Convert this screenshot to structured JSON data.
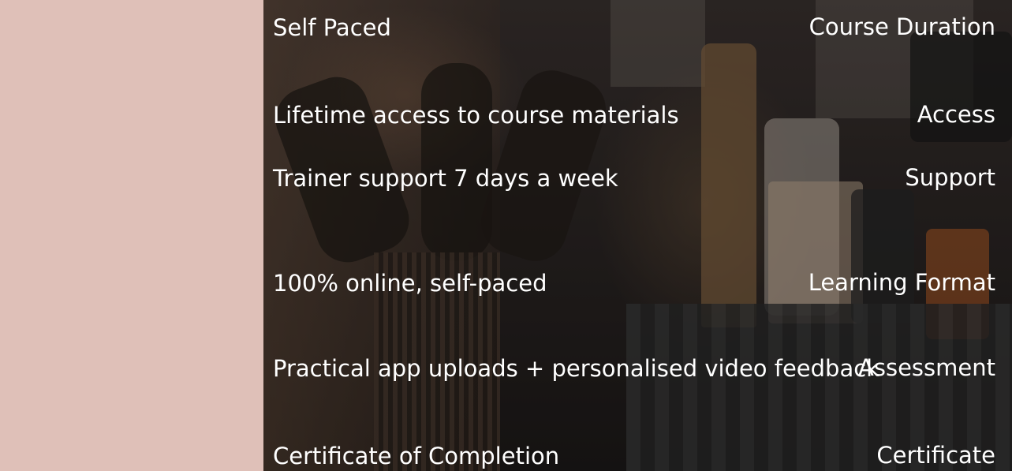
{
  "colors": {
    "label_column_bg": "#dfc0b8",
    "label_text": "#ffffff",
    "value_text": "#ffffff"
  },
  "rows": [
    {
      "label": "Course Duration",
      "value": "Self Paced"
    },
    {
      "label": "Access",
      "value": "Lifetime access to course materials"
    },
    {
      "label": "Support",
      "value": "Trainer support 7 days a week"
    },
    {
      "label": "Learning Format",
      "value": "100% online, self-paced"
    },
    {
      "label": "Assessment",
      "value": "Practical app uploads + personalised video feedback"
    },
    {
      "label": "Certificate",
      "value": "Certificate of Completion"
    }
  ]
}
